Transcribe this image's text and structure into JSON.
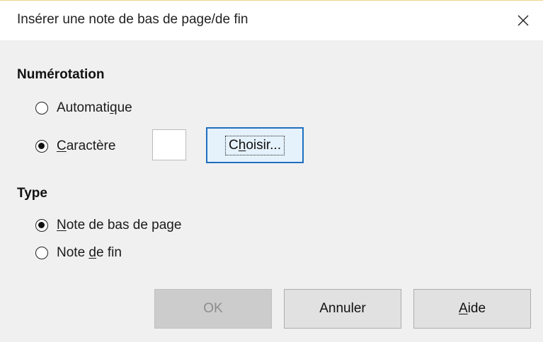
{
  "window": {
    "title": "Insérer une note de bas de page/de fin",
    "close_icon": "close-icon"
  },
  "numbering": {
    "heading": "Numérotation",
    "automatic": {
      "label_pre": "Automati",
      "label_mnemonic": "q",
      "label_post": "ue",
      "selected": false
    },
    "character": {
      "label_pre": "",
      "label_mnemonic": "C",
      "label_post": "aractère",
      "selected": true,
      "input_value": ""
    },
    "choose_button": {
      "label_pre": "C",
      "label_mnemonic": "h",
      "label_post": "oisir..."
    }
  },
  "type": {
    "heading": "Type",
    "footnote": {
      "label_pre": "",
      "label_mnemonic": "N",
      "label_post": "ote de bas de page",
      "selected": true
    },
    "endnote": {
      "label_pre": "Note ",
      "label_mnemonic": "d",
      "label_post": "e fin",
      "selected": false
    }
  },
  "buttons": {
    "ok": "OK",
    "cancel": "Annuler",
    "help_pre": "",
    "help_mnemonic": "A",
    "help_post": "ide"
  },
  "colors": {
    "focus_border": "#1f6fbf",
    "focus_fill": "#e5f1fb",
    "disabled_text": "#8d8d8d"
  }
}
